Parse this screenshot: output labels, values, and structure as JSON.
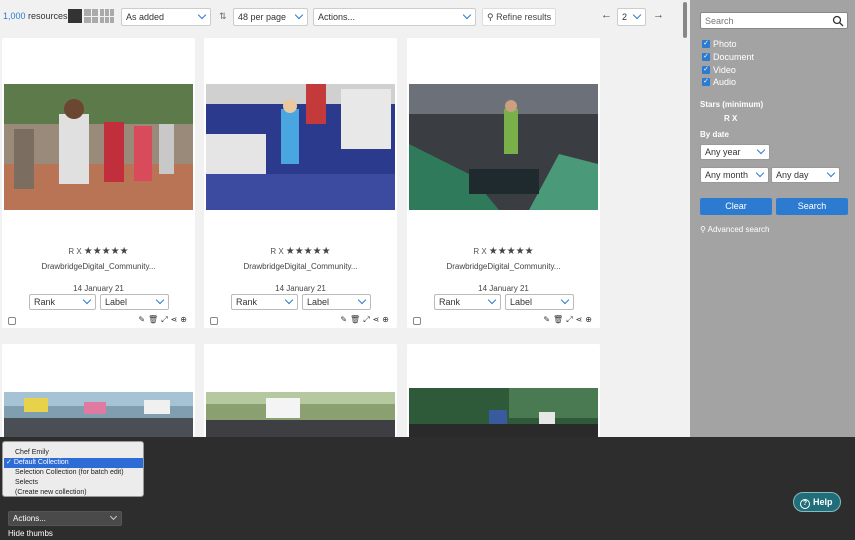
{
  "toolbar": {
    "count": "1,000",
    "count_suffix": " resources",
    "sort": "As added",
    "per_page": "48 per page",
    "actions": "Actions...",
    "refine": "Refine results",
    "page": "2"
  },
  "cards": [
    {
      "rx": "R X",
      "stars": "★★★★★",
      "filename": "DrawbridgeDigital_Community...",
      "date": "14 January 21",
      "rank": "Rank",
      "label": "Label"
    },
    {
      "rx": "R X",
      "stars": "★★★★★",
      "filename": "DrawbridgeDigital_Community...",
      "date": "14 January 21",
      "rank": "Rank",
      "label": "Label"
    },
    {
      "rx": "R X",
      "stars": "★★★★★",
      "filename": "DrawbridgeDigital_Community...",
      "date": "14 January 21",
      "rank": "Rank",
      "label": "Label"
    }
  ],
  "sidebar": {
    "search_placeholder": "Search",
    "types": [
      "Photo",
      "Document",
      "Video",
      "Audio"
    ],
    "stars_label": "Stars (minimum)",
    "stars_rx": "R X",
    "by_date": "By date",
    "year": "Any year",
    "month": "Any month",
    "day": "Any day",
    "clear": "Clear",
    "search": "Search",
    "advanced": "Advanced search"
  },
  "bottom": {
    "collections": [
      "Chef Emily",
      "Default Collection",
      "Selection Collection (for batch edit)",
      "Selects",
      "(Create new collection)"
    ],
    "actions": "Actions...",
    "hide_thumbs": "Hide thumbs",
    "help": "Help"
  }
}
